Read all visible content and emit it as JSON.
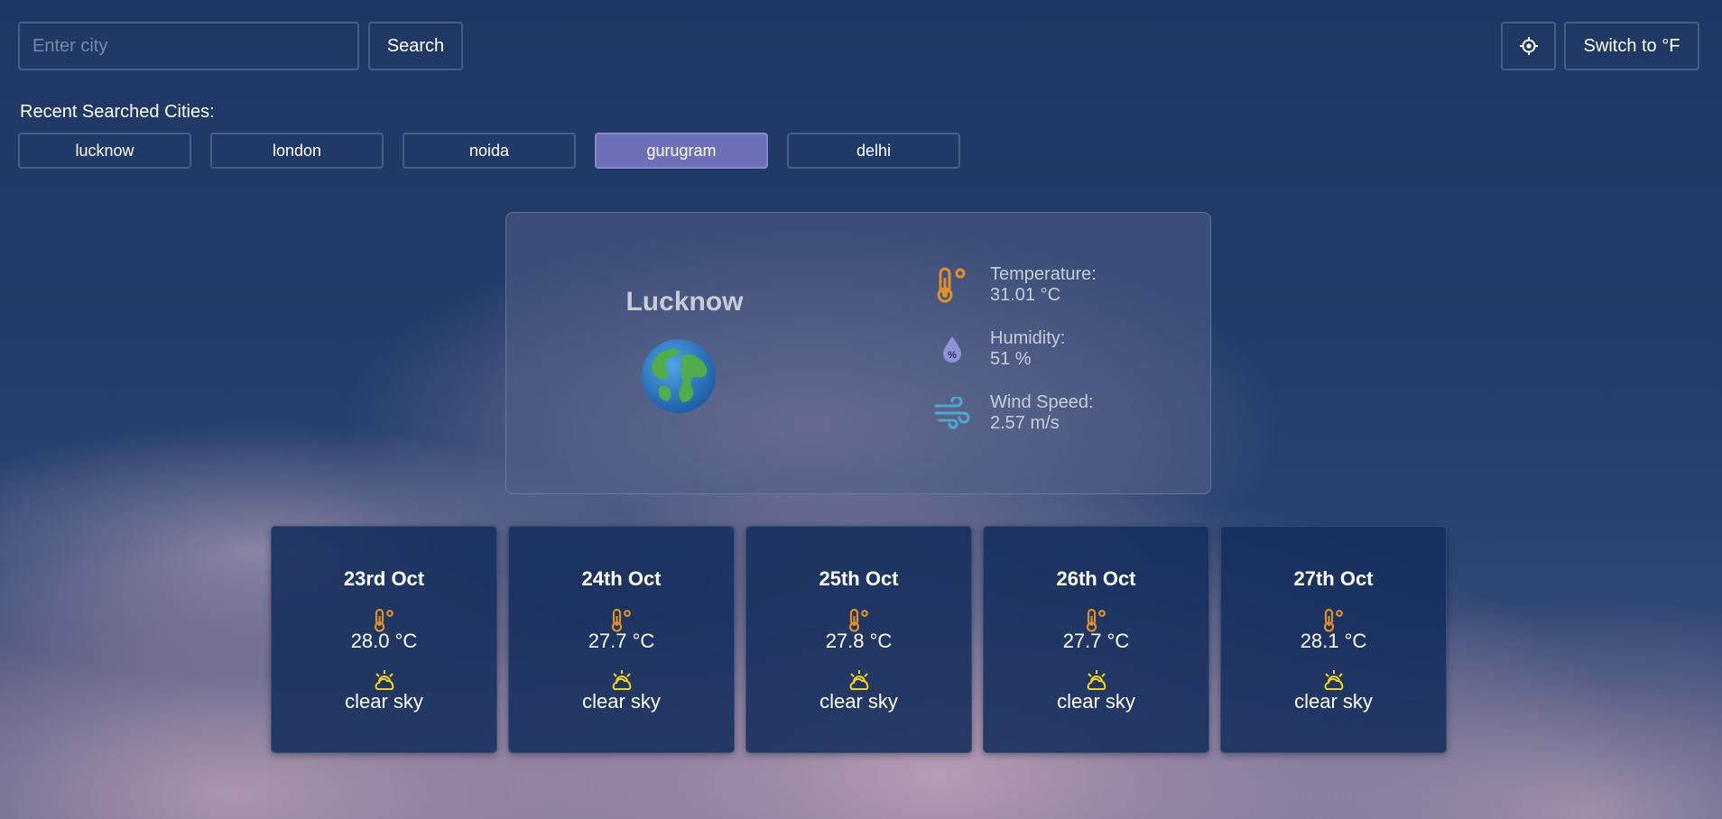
{
  "search": {
    "placeholder": "Enter city",
    "button_label": "Search"
  },
  "toolbar": {
    "locate_icon": "crosshair-icon",
    "unit_toggle_label": "Switch to °F"
  },
  "recent": {
    "label": "Recent Searched Cities:",
    "cities": [
      "lucknow",
      "london",
      "noida",
      "gurugram",
      "delhi"
    ],
    "active": "gurugram",
    "active_color": "#6d6fb8"
  },
  "current": {
    "city": "Lucknow",
    "icon": "globe-icon",
    "temperature": {
      "label": "Temperature:",
      "value": "31.01 °C",
      "icon": "thermometer-icon"
    },
    "humidity": {
      "label": "Humidity:",
      "value": "51 %",
      "icon": "humidity-drop-icon"
    },
    "wind": {
      "label": "Wind Speed:",
      "value": "2.57 m/s",
      "icon": "wind-icon"
    }
  },
  "forecast": [
    {
      "date": "23rd Oct",
      "temp": "28.0 °C",
      "condition": "clear sky"
    },
    {
      "date": "24th Oct",
      "temp": "27.7 °C",
      "condition": "clear sky"
    },
    {
      "date": "25th Oct",
      "temp": "27.8 °C",
      "condition": "clear sky"
    },
    {
      "date": "26th Oct",
      "temp": "27.7 °C",
      "condition": "clear sky"
    },
    {
      "date": "27th Oct",
      "temp": "28.1 °C",
      "condition": "clear sky"
    }
  ],
  "colors": {
    "accent_orange": "#e0902a",
    "humidity_purple": "#8f92d8",
    "wind_blue": "#4fa8d0",
    "sun_yellow": "#f2d21a",
    "card_bg": "#142e5c"
  }
}
